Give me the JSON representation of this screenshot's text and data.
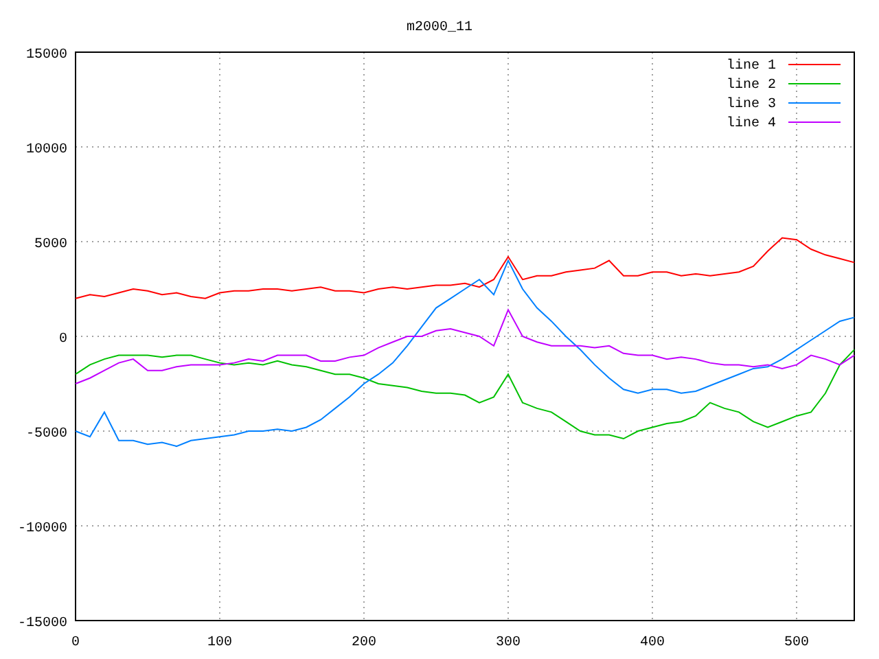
{
  "chart_data": {
    "type": "line",
    "title": "m2000_11",
    "x": [
      0,
      10,
      20,
      30,
      40,
      50,
      60,
      70,
      80,
      90,
      100,
      110,
      120,
      130,
      140,
      150,
      160,
      170,
      180,
      190,
      200,
      210,
      220,
      230,
      240,
      250,
      260,
      270,
      280,
      290,
      300,
      310,
      320,
      330,
      340,
      350,
      360,
      370,
      380,
      390,
      400,
      410,
      420,
      430,
      440,
      450,
      460,
      470,
      480,
      490,
      500,
      510,
      520,
      530,
      540
    ],
    "series": [
      {
        "name": "line 1",
        "color": "#ff0000",
        "values": [
          2000,
          2200,
          2100,
          2300,
          2500,
          2400,
          2200,
          2300,
          2100,
          2000,
          2300,
          2400,
          2400,
          2500,
          2500,
          2400,
          2500,
          2600,
          2400,
          2400,
          2300,
          2500,
          2600,
          2500,
          2600,
          2700,
          2700,
          2800,
          2600,
          3000,
          4200,
          3000,
          3200,
          3200,
          3400,
          3500,
          3600,
          4000,
          3200,
          3200,
          3400,
          3400,
          3200,
          3300,
          3200,
          3300,
          3400,
          3700,
          4500,
          5200,
          5100,
          4600,
          4300,
          4100,
          3900
        ]
      },
      {
        "name": "line 2",
        "color": "#00c000",
        "values": [
          -2000,
          -1500,
          -1200,
          -1000,
          -1000,
          -1000,
          -1100,
          -1000,
          -1000,
          -1200,
          -1400,
          -1500,
          -1400,
          -1500,
          -1300,
          -1500,
          -1600,
          -1800,
          -2000,
          -2000,
          -2200,
          -2500,
          -2600,
          -2700,
          -2900,
          -3000,
          -3000,
          -3100,
          -3500,
          -3200,
          -2000,
          -3500,
          -3800,
          -4000,
          -4500,
          -5000,
          -5200,
          -5200,
          -5400,
          -5000,
          -4800,
          -4600,
          -4500,
          -4200,
          -3500,
          -3800,
          -4000,
          -4500,
          -4800,
          -4500,
          -4200,
          -4000,
          -3000,
          -1500,
          -700
        ]
      },
      {
        "name": "line 3",
        "color": "#0080ff",
        "values": [
          -5000,
          -5300,
          -4000,
          -5500,
          -5500,
          -5700,
          -5600,
          -5800,
          -5500,
          -5400,
          -5300,
          -5200,
          -5000,
          -5000,
          -4900,
          -5000,
          -4800,
          -4400,
          -3800,
          -3200,
          -2500,
          -2000,
          -1400,
          -500,
          500,
          1500,
          2000,
          2500,
          3000,
          2200,
          4000,
          2500,
          1500,
          800,
          0,
          -700,
          -1500,
          -2200,
          -2800,
          -3000,
          -2800,
          -2800,
          -3000,
          -2900,
          -2600,
          -2300,
          -2000,
          -1700,
          -1600,
          -1200,
          -700,
          -200,
          300,
          800,
          1000
        ]
      },
      {
        "name": "line 4",
        "color": "#c000ff",
        "values": [
          -2500,
          -2200,
          -1800,
          -1400,
          -1200,
          -1800,
          -1800,
          -1600,
          -1500,
          -1500,
          -1500,
          -1400,
          -1200,
          -1300,
          -1000,
          -1000,
          -1000,
          -1300,
          -1300,
          -1100,
          -1000,
          -600,
          -300,
          0,
          0,
          300,
          400,
          200,
          0,
          -500,
          1400,
          0,
          -300,
          -500,
          -500,
          -500,
          -600,
          -500,
          -900,
          -1000,
          -1000,
          -1200,
          -1100,
          -1200,
          -1400,
          -1500,
          -1500,
          -1600,
          -1500,
          -1700,
          -1500,
          -1000,
          -1200,
          -1500,
          -1000
        ]
      }
    ],
    "xlim": [
      0,
      540
    ],
    "ylim": [
      -15000,
      15000
    ],
    "xticks": [
      0,
      100,
      200,
      300,
      400,
      500
    ],
    "yticks": [
      -15000,
      -10000,
      -5000,
      0,
      5000,
      10000,
      15000
    ],
    "grid": true,
    "legend": true
  }
}
